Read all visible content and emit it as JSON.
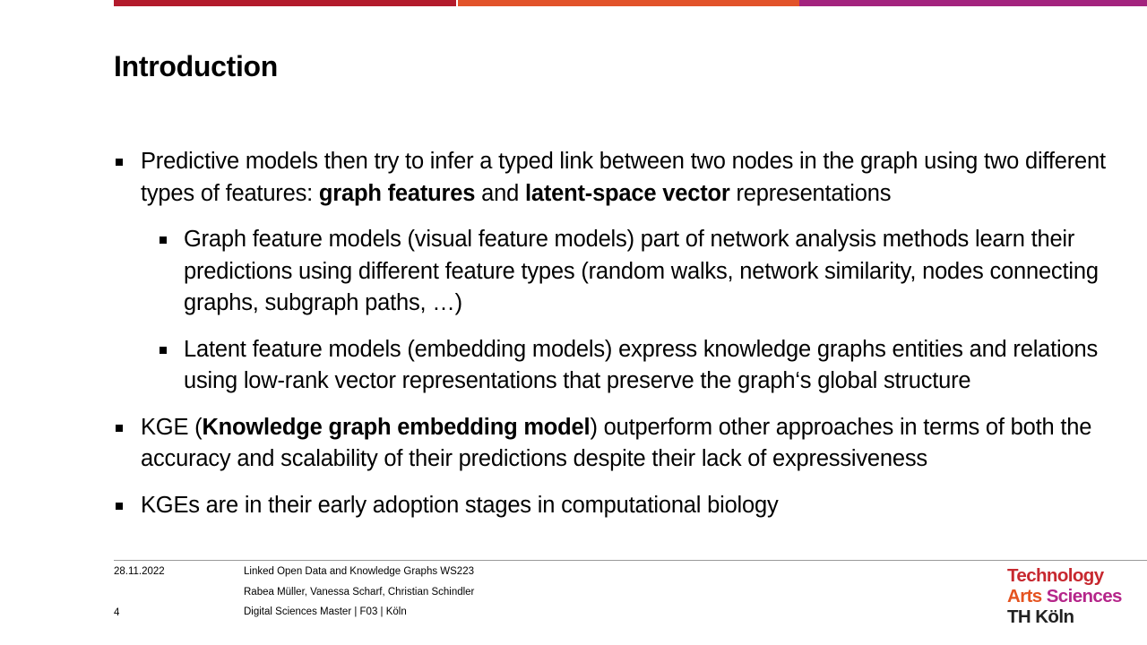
{
  "colors": {
    "bar1": "#b31b2c",
    "bar2": "#e2532a",
    "bar3": "#a3237e"
  },
  "title": "Introduction",
  "bullets": {
    "b1": {
      "t1": "Predictive models then try to infer a typed link between two nodes in the graph using two different types of features: ",
      "bold1": "graph features",
      "t2": " and ",
      "bold2": "latent-space vector",
      "t3": " representations"
    },
    "b1a": "Graph feature models (visual feature models) part of network analysis methods learn their predictions using different feature types (random walks, network similarity, nodes connecting graphs, subgraph paths, …)",
    "b1b": "Latent feature models (embedding models) express knowledge graphs entities and relations using low-rank vector representations that preserve the graph‘s global structure",
    "b2": {
      "t1": "KGE (",
      "bold": "Knowledge graph embedding model",
      "t2": ") outperform other approaches in terms of both the accuracy and scalability of their predictions despite their lack of expressiveness"
    },
    "b3": "KGEs are in their early adoption stages in computational biology"
  },
  "footer": {
    "date": "28.11.2022",
    "page": "4",
    "line1": "Linked Open Data and Knowledge Graphs WS223",
    "line2": "Rabea Müller, Vanessa Scharf, Christian Schindler",
    "line3": "Digital Sciences Master | F03 | Köln"
  },
  "logo": {
    "line1": "Technology",
    "line2a": "Arts ",
    "line2b": "Sciences",
    "line3": "TH Köln"
  }
}
